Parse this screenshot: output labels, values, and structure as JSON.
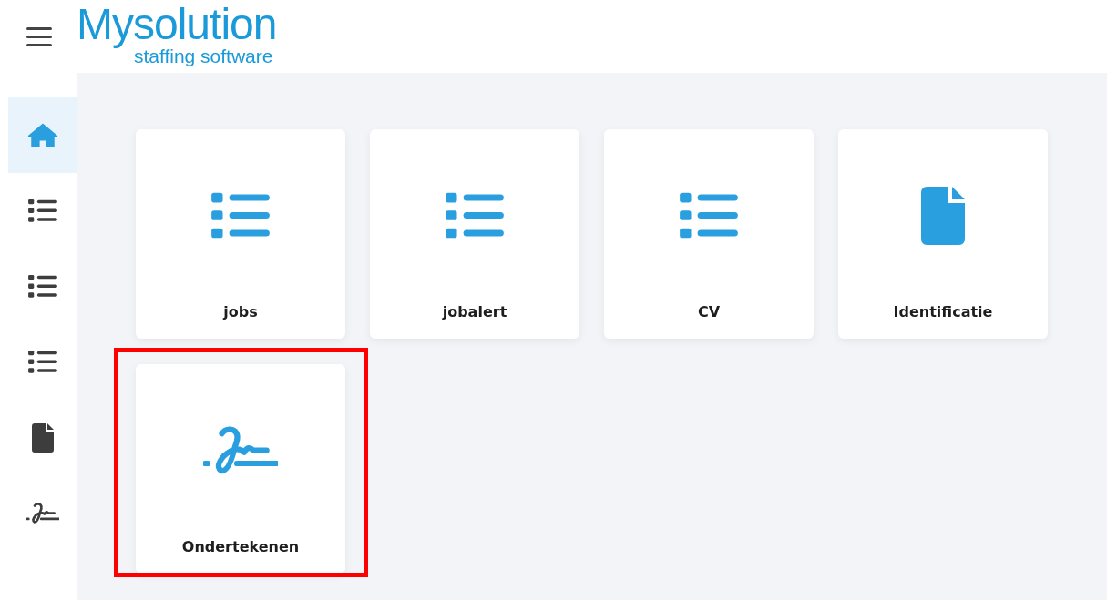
{
  "header": {
    "logo": {
      "title": "Mysolution",
      "subtitle": "staffing software"
    }
  },
  "sidebar": {
    "items": [
      {
        "kind": "home",
        "selected": true
      },
      {
        "kind": "list",
        "selected": false
      },
      {
        "kind": "list",
        "selected": false
      },
      {
        "kind": "list",
        "selected": false
      },
      {
        "kind": "file",
        "selected": false
      },
      {
        "kind": "signature",
        "selected": false
      }
    ]
  },
  "tiles": [
    {
      "label": "jobs",
      "kind": "list",
      "highlighted": false
    },
    {
      "label": "jobalert",
      "kind": "list",
      "highlighted": false
    },
    {
      "label": "CV",
      "kind": "list",
      "highlighted": false
    },
    {
      "label": "Identificatie",
      "kind": "file",
      "highlighted": false
    },
    {
      "label": "Ondertekenen",
      "kind": "signature",
      "highlighted": true
    }
  ]
}
